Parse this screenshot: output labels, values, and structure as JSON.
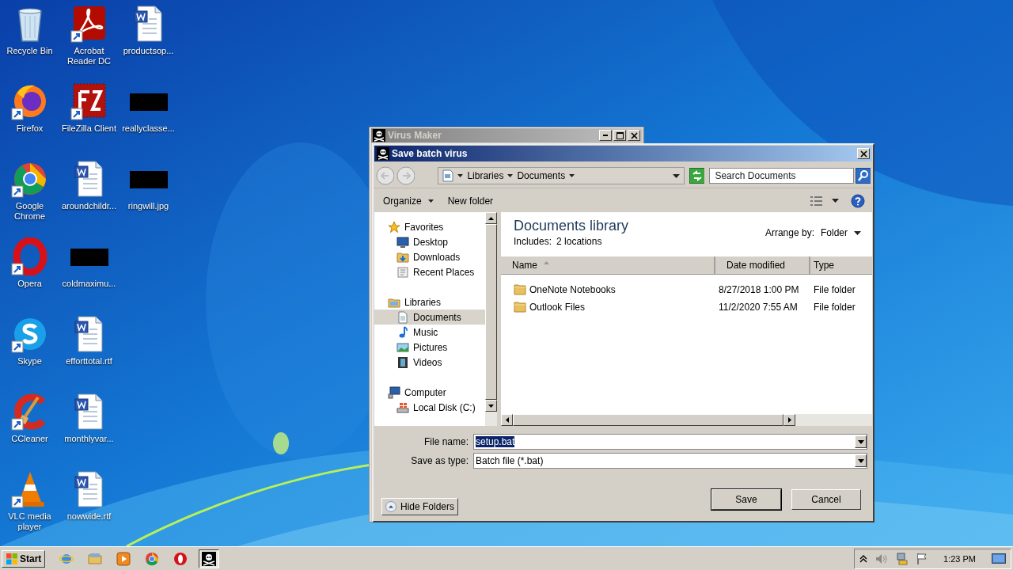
{
  "desktop": {
    "columns": [
      [
        {
          "label": "Recycle Bin",
          "kind": "recycle",
          "shortcut": false
        },
        {
          "label": "Firefox",
          "kind": "firefox",
          "shortcut": true
        },
        {
          "label": "Google Chrome",
          "kind": "chrome",
          "shortcut": true
        },
        {
          "label": "Opera",
          "kind": "opera",
          "shortcut": true
        },
        {
          "label": "Skype",
          "kind": "skype",
          "shortcut": true
        },
        {
          "label": "CCleaner",
          "kind": "ccleaner",
          "shortcut": true
        },
        {
          "label": "VLC media player",
          "kind": "vlc",
          "shortcut": true
        }
      ],
      [
        {
          "label": "Acrobat Reader DC",
          "kind": "acrobat",
          "shortcut": true
        },
        {
          "label": "FileZilla Client",
          "kind": "filezilla",
          "shortcut": true
        },
        {
          "label": "aroundchildr...",
          "kind": "word",
          "shortcut": false
        },
        {
          "label": "coldmaximu...",
          "kind": "redacted",
          "shortcut": false
        },
        {
          "label": "efforttotal.rtf",
          "kind": "word",
          "shortcut": false
        },
        {
          "label": "monthlyvar...",
          "kind": "word",
          "shortcut": false
        },
        {
          "label": "nowwide.rtf",
          "kind": "word",
          "shortcut": false
        }
      ],
      [
        {
          "label": "productsop...",
          "kind": "word",
          "shortcut": false
        },
        {
          "label": "reallyclasse...",
          "kind": "redacted",
          "shortcut": false
        },
        {
          "label": "ringwill.jpg",
          "kind": "redacted",
          "shortcut": false
        }
      ]
    ]
  },
  "back_window": {
    "title": "Virus Maker"
  },
  "dialog": {
    "title": "Save batch virus",
    "breadcrumb": [
      "Libraries",
      "Documents"
    ],
    "search": {
      "placeholder": "Search Documents"
    },
    "toolbar": {
      "organize": "Organize",
      "new_folder": "New folder"
    },
    "nav": [
      {
        "label": "Favorites",
        "kind": "star",
        "selected": false,
        "children": [
          {
            "label": "Desktop",
            "kind": "desktop",
            "selected": false
          },
          {
            "label": "Downloads",
            "kind": "downloads",
            "selected": false
          },
          {
            "label": "Recent Places",
            "kind": "recent",
            "selected": false
          }
        ]
      },
      {
        "label": "Libraries",
        "kind": "libraries",
        "selected": false,
        "children": [
          {
            "label": "Documents",
            "kind": "documents",
            "selected": true
          },
          {
            "label": "Music",
            "kind": "music",
            "selected": false
          },
          {
            "label": "Pictures",
            "kind": "pictures",
            "selected": false
          },
          {
            "label": "Videos",
            "kind": "videos",
            "selected": false
          }
        ]
      },
      {
        "label": "Computer",
        "kind": "computer",
        "selected": false,
        "children": [
          {
            "label": "Local Disk (C:)",
            "kind": "disk",
            "selected": false
          }
        ]
      }
    ],
    "library": {
      "title": "Documents library",
      "includes_label": "Includes:",
      "includes_value": "2 locations",
      "arrange_label": "Arrange by:",
      "arrange_value": "Folder"
    },
    "columns": [
      {
        "label": "Name",
        "sorted": true
      },
      {
        "label": "Date modified",
        "sorted": false
      },
      {
        "label": "Type",
        "sorted": false
      }
    ],
    "rows": [
      {
        "name": "OneNote Notebooks",
        "date": "8/27/2018 1:00 PM",
        "type": "File folder"
      },
      {
        "name": "Outlook Files",
        "date": "11/2/2020 7:55 AM",
        "type": "File folder"
      }
    ],
    "file_name": {
      "label": "File name:",
      "value": "setup.bat",
      "selected": true
    },
    "save_type": {
      "label": "Save as type:",
      "value": "Batch file (*.bat)"
    },
    "hide_folders": "Hide Folders",
    "buttons": [
      {
        "label": "Save",
        "default": true
      },
      {
        "label": "Cancel",
        "default": false
      }
    ]
  },
  "taskbar": {
    "start": "Start",
    "apps": [
      {
        "kind": "ie",
        "active": false
      },
      {
        "kind": "explorer",
        "active": false
      },
      {
        "kind": "media",
        "active": false
      },
      {
        "kind": "chrome",
        "active": false
      },
      {
        "kind": "opera",
        "active": false
      },
      {
        "kind": "pirate",
        "active": true
      }
    ],
    "clock": "1:23 PM"
  }
}
